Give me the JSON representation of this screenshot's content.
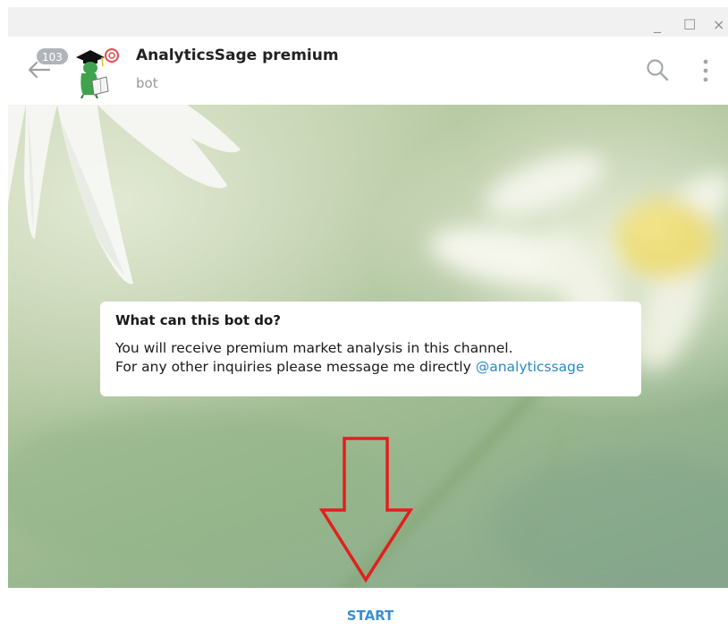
{
  "window": {
    "minimize_glyph": "_",
    "maximize_glyph": "☐",
    "close_glyph": "×"
  },
  "header": {
    "unread_count": "103",
    "title": "AnalyticsSage premium",
    "subtitle": "bot",
    "icons": [
      "back-arrow-icon",
      "search-icon",
      "more-vertical-icon"
    ]
  },
  "bot_info": {
    "heading": "What can this bot do?",
    "line1": "You will receive premium market analysis in this channel.",
    "line2_text": "For any other inquiries please message me directly ",
    "mention": "@analyticssage"
  },
  "footer": {
    "start_label": "START"
  },
  "colors": {
    "accent": "#3a8fd0",
    "mention": "#2a8ac6",
    "arrow": "#e0201e",
    "badge": "#b0b5ba"
  }
}
